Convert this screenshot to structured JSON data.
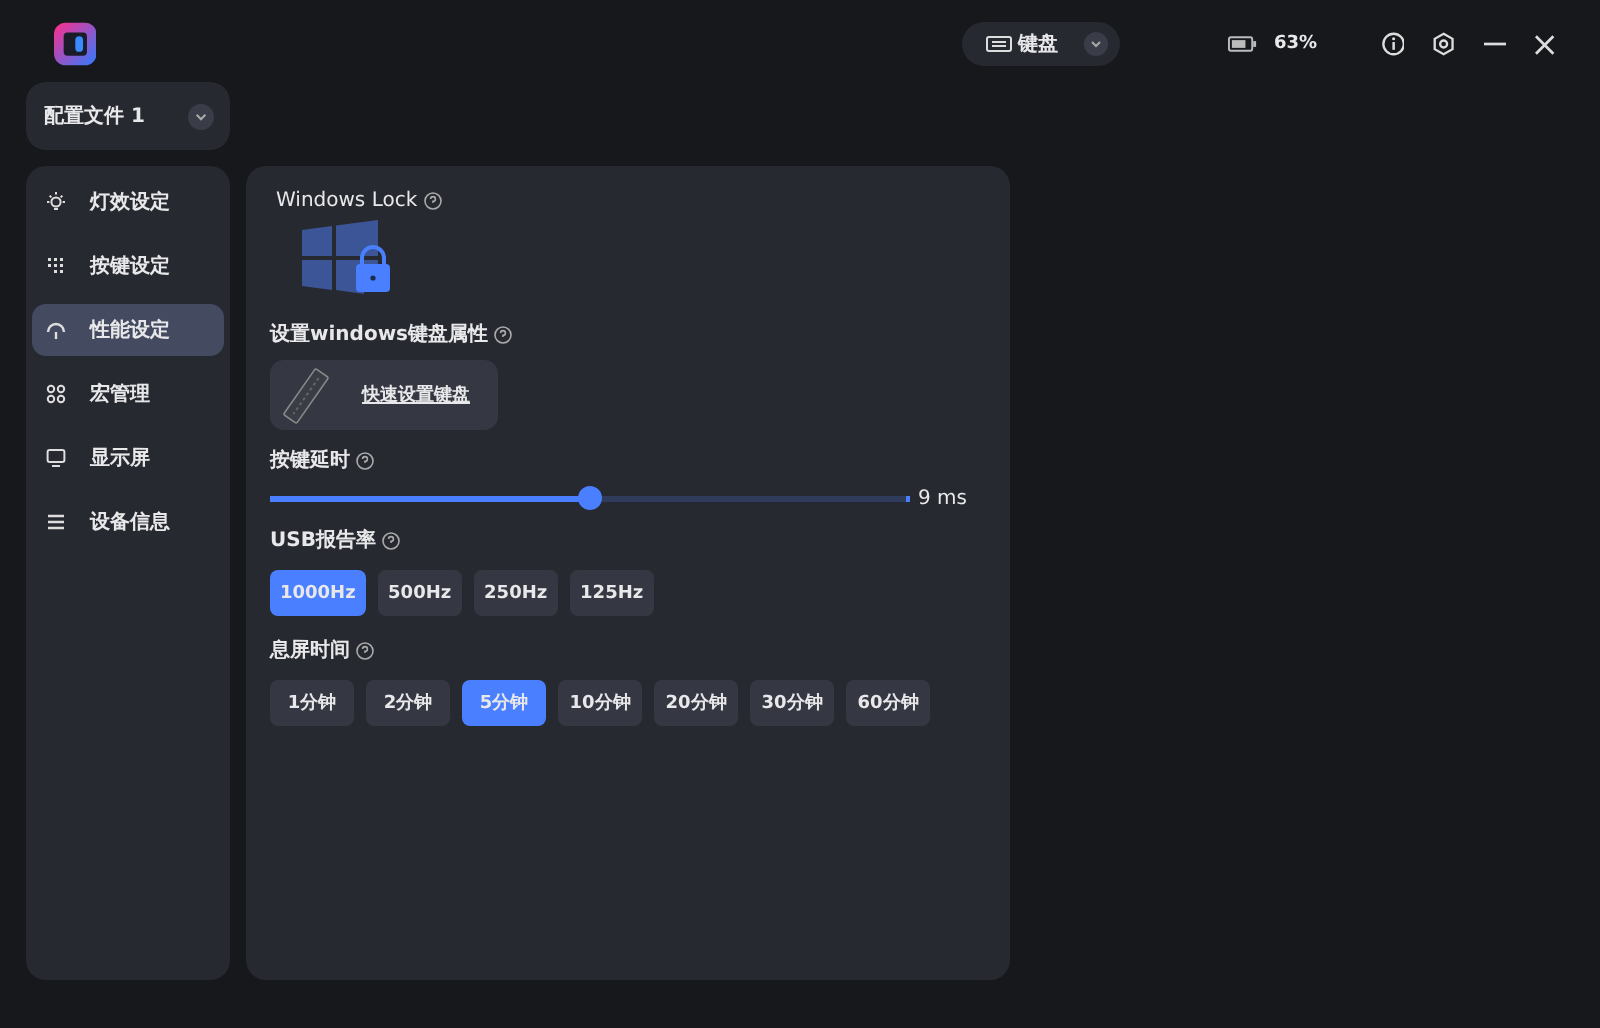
{
  "device": {
    "label": "键盘"
  },
  "battery": {
    "reading": "63%"
  },
  "profile": {
    "label": "配置文件 1"
  },
  "sidebar": {
    "items": [
      {
        "label": "灯效设定",
        "kind": "bulb",
        "selected": false
      },
      {
        "label": "按键设定",
        "kind": "keys",
        "selected": false
      },
      {
        "label": "性能设定",
        "kind": "gauge",
        "selected": true
      },
      {
        "label": "宏管理",
        "kind": "macro",
        "selected": false
      },
      {
        "label": "显示屏",
        "kind": "monitor",
        "selected": false
      },
      {
        "label": "设备信息",
        "kind": "list",
        "selected": false
      }
    ]
  },
  "windows_lock": {
    "title": "Windows Lock"
  },
  "keyboard_props": {
    "title": "设置windows键盘属性",
    "link": "快速设置键盘"
  },
  "key_delay": {
    "title": "按键延时",
    "level": 0.5,
    "reading": "9 ms"
  },
  "usb_rate": {
    "title": "USB报告率",
    "options": [
      {
        "label": "1000Hz",
        "selected": true
      },
      {
        "label": "500Hz",
        "selected": false
      },
      {
        "label": "250Hz",
        "selected": false
      },
      {
        "label": "125Hz",
        "selected": false
      }
    ]
  },
  "screen_off": {
    "title": "息屏时间",
    "options": [
      {
        "label": "1分钟",
        "selected": false
      },
      {
        "label": "2分钟",
        "selected": false
      },
      {
        "label": "5分钟",
        "selected": true
      },
      {
        "label": "10分钟",
        "selected": false
      },
      {
        "label": "20分钟",
        "selected": false
      },
      {
        "label": "30分钟",
        "selected": false
      },
      {
        "label": "60分钟",
        "selected": false
      }
    ]
  }
}
